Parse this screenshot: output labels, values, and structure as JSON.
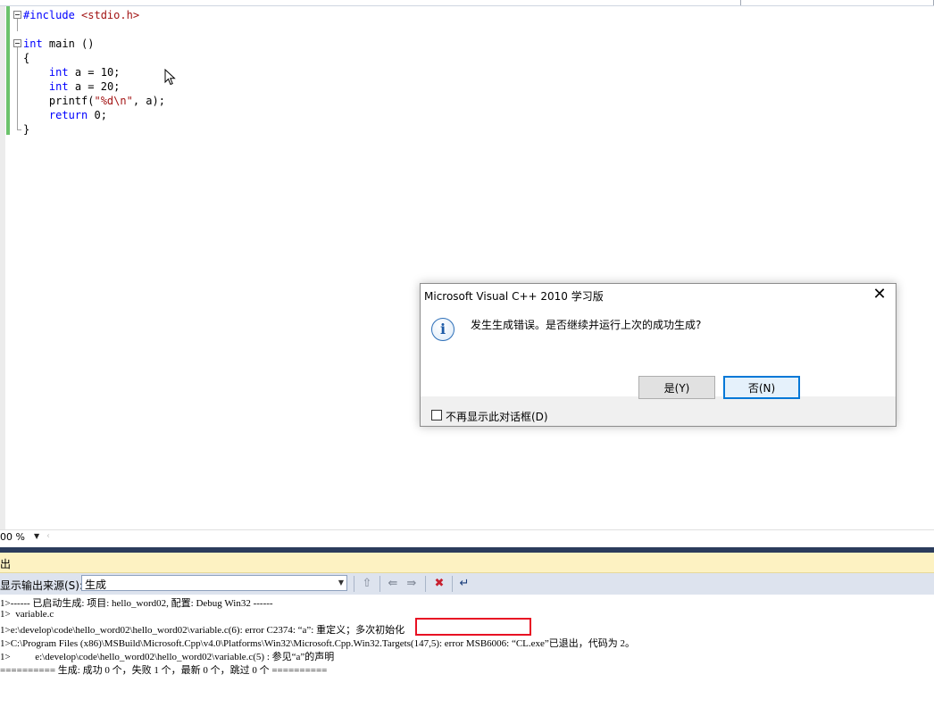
{
  "editor": {
    "code_lines": [
      {
        "parts": [
          {
            "t": "#include ",
            "c": "kw"
          },
          {
            "t": "<stdio.h>",
            "c": "str"
          }
        ]
      },
      {
        "parts": []
      },
      {
        "parts": [
          {
            "t": "int",
            "c": "kw"
          },
          {
            "t": " main ()",
            "c": ""
          }
        ]
      },
      {
        "parts": [
          {
            "t": "{",
            "c": ""
          }
        ]
      },
      {
        "parts": [
          {
            "t": "    ",
            "c": ""
          },
          {
            "t": "int",
            "c": "kw"
          },
          {
            "t": " a = 10;",
            "c": ""
          }
        ]
      },
      {
        "parts": [
          {
            "t": "    ",
            "c": ""
          },
          {
            "t": "int",
            "c": "kw"
          },
          {
            "t": " a = 20;",
            "c": ""
          }
        ]
      },
      {
        "parts": [
          {
            "t": "    printf(",
            "c": ""
          },
          {
            "t": "\"%d\\n\"",
            "c": "str"
          },
          {
            "t": ", a);",
            "c": ""
          }
        ]
      },
      {
        "parts": [
          {
            "t": "    ",
            "c": ""
          },
          {
            "t": "return",
            "c": "kw"
          },
          {
            "t": " 0;",
            "c": ""
          }
        ]
      },
      {
        "parts": [
          {
            "t": "}",
            "c": ""
          }
        ]
      }
    ],
    "zoom_value": "00 %",
    "change_bar_color": "#6cc36c"
  },
  "output": {
    "title": "出",
    "source_label": "显示输出来源(S):",
    "source_value": "生成",
    "toolbar_icons": [
      "goto-current-icon",
      "prev-message-icon",
      "next-message-icon",
      "clear-all-icon",
      "word-wrap-icon"
    ],
    "lines": [
      "1>------ 已启动生成: 项目: hello_word02, 配置: Debug Win32 ------",
      "1>  variable.c",
      "1>e:\\develop\\code\\hello_word02\\hello_word02\\variable.c(6): error C2374: “a”: 重定义；多次初始化",
      "1>C:\\Program Files (x86)\\MSBuild\\Microsoft.Cpp\\v4.0\\Platforms\\Win32\\Microsoft.Cpp.Win32.Targets(147,5): error MSB6006: “CL.exe”已退出，代码为 2。",
      "1>          e:\\develop\\code\\hello_word02\\hello_word02\\variable.c(5) : 参见“a”的声明",
      "========== 生成: 成功 0 个，失败 1 个，最新 0 个，跳过 0 个 =========="
    ],
    "highlight_color": "#e81123"
  },
  "dialog": {
    "title": "Microsoft Visual C++ 2010 学习版",
    "close_glyph": "✕",
    "icon_glyph": "i",
    "message": "发生生成错误。是否继续并运行上次的成功生成?",
    "yes_label": "是(Y)",
    "no_label": "否(N)",
    "checkbox_label": "不再显示此对话框(D)",
    "checkbox_checked": false
  }
}
